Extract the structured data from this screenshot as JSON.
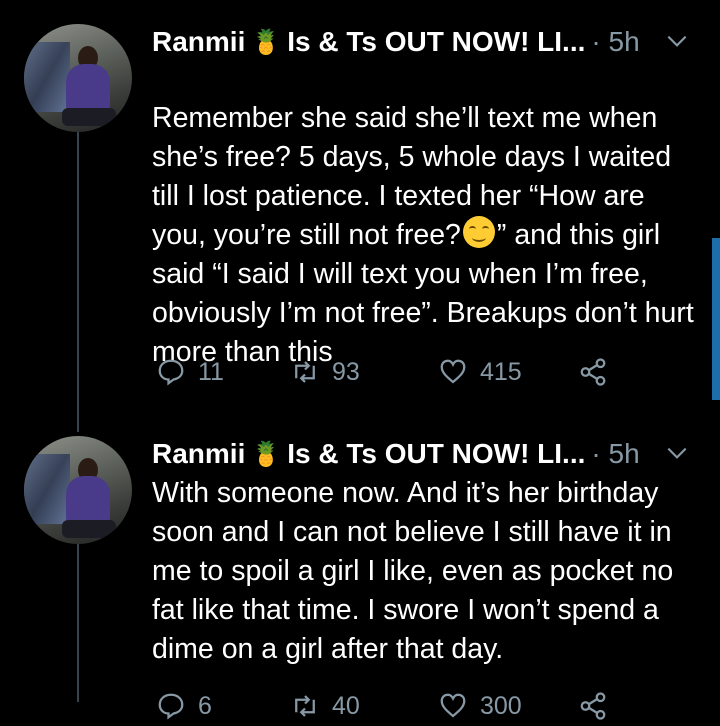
{
  "tweets": [
    {
      "author": "Ranmii",
      "author_suffix": "Is & Ts OUT NOW! LI...",
      "time": "· 5h",
      "text": "Remember she said she’ll text me when she’s free? 5 days, 5 whole days I waited till I lost patience. I texted her “How are you, you’re still not free?",
      "text_after_emoji": "” and this girl said “I said I will text you when I’m free, obviously I’m not free”. Breakups don’t hurt more than this",
      "replies": "11",
      "retweets": "93",
      "likes": "415"
    },
    {
      "author": "Ranmii",
      "author_suffix": "Is & Ts OUT NOW! LI...",
      "time": "· 5h",
      "text": "With someone now. And it’s her birthday soon and I can not believe I still have it in me to spoil a girl I like, even as pocket no fat like that time. I swore I won’t spend a dime on a girl after that day.",
      "replies": "6",
      "retweets": "40",
      "likes": "300"
    }
  ],
  "icons": {
    "reply": "reply-icon",
    "retweet": "retweet-icon",
    "like": "heart-icon",
    "share": "share-icon",
    "caret": "chevron-down-icon",
    "pineapple": "pineapple-emoji",
    "smile": "smiling-face-emoji"
  },
  "colors": {
    "background": "#000000",
    "text": "#ffffff",
    "secondary": "#8899a6",
    "thread_line": "#38444d",
    "scroll_indicator": "#1d6ea8"
  }
}
